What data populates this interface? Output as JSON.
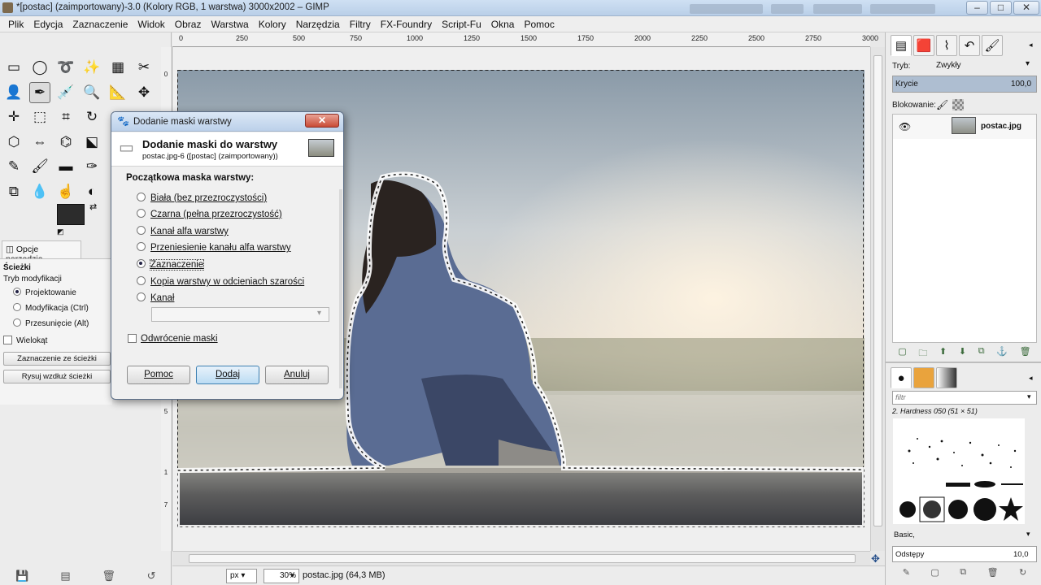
{
  "window": {
    "title": "*[postac] (zaimportowany)-3.0 (Kolory RGB, 1 warstwa) 3000x2002 – GIMP",
    "controls": {
      "minimize": "–",
      "maximize": "□",
      "close": "✕"
    }
  },
  "menubar": [
    "Plik",
    "Edycja",
    "Zaznaczenie",
    "Widok",
    "Obraz",
    "Warstwa",
    "Kolory",
    "Narzędzia",
    "Filtry",
    "FX-Foundry",
    "Script-Fu",
    "Okna",
    "Pomoc"
  ],
  "toolbox": {
    "tools": [
      "rect-select",
      "ellipse-select",
      "free-select",
      "fuzzy-select",
      "select-by-color",
      "scissors-select",
      "foreground-select",
      "paths",
      "color-picker",
      "zoom",
      "measure",
      "move",
      "align",
      "transform",
      "crop",
      "rotate",
      "scale",
      "shear",
      "perspective",
      "flip",
      "cage",
      "unified-transform",
      "text",
      "bucket-fill",
      "pencil",
      "airbrush",
      "eraser",
      "ink",
      "heal",
      "clone",
      "perspective-clone",
      "blur",
      "smudge",
      "dodge-burn",
      "colors"
    ],
    "colors": {
      "foreground": "#2c2c2c",
      "background": "#ffffff"
    },
    "options_tab": "Opcje narzędzia",
    "options": {
      "heading": "Ścieżki",
      "mode_label": "Tryb modyfikacji",
      "modes": [
        "Projektowanie",
        "Modyfikacja (Ctrl)",
        "Przesunięcie (Alt)"
      ],
      "selected_mode": "Projektowanie",
      "polygonal": "Wielokąt",
      "btn_selection": "Zaznaczenie ze ścieżki",
      "btn_stroke": "Rysuj wzdłuż ścieżki"
    }
  },
  "ruler": {
    "ticks": [
      "0",
      "250",
      "500",
      "750",
      "1000",
      "1250",
      "1500",
      "1750",
      "2000",
      "2250",
      "2500",
      "2750",
      "3000"
    ]
  },
  "statusbar": {
    "unit": "px",
    "zoom": "30%",
    "info": "postac.jpg (64,3 MB)"
  },
  "dialog": {
    "title": "Dodanie maski warstwy",
    "header": "Dodanie maski do warstwy",
    "subheader": "postac.jpg-6 ([postac] (zaimportowany))",
    "section": "Początkowa maska warstwy:",
    "options": [
      "Biała (bez przezroczystości)",
      "Czarna (pełna przezroczystość)",
      "Kanał alfa warstwy",
      "Przeniesienie kanału alfa warstwy",
      "Zaznaczenie",
      "Kopia warstwy w odcieniach szarości",
      "Kanał"
    ],
    "selected": "Zaznaczenie",
    "channel_value": "",
    "invert": "Odwrócenie maski",
    "buttons": {
      "help": "Pomoc",
      "add": "Dodaj",
      "cancel": "Anuluj"
    }
  },
  "layers_panel": {
    "mode_label": "Tryb:",
    "mode_value": "Zwykły",
    "opacity_label": "Krycie",
    "opacity_value": "100,0",
    "lock_label": "Blokowanie:",
    "layer_name": "postac.jpg"
  },
  "brushes_panel": {
    "filter_placeholder": "filtr",
    "brush_name": "2. Hardness 050 (51 × 51)",
    "tag": "Basic,",
    "spacing_label": "Odstępy",
    "spacing_value": "10,0"
  }
}
